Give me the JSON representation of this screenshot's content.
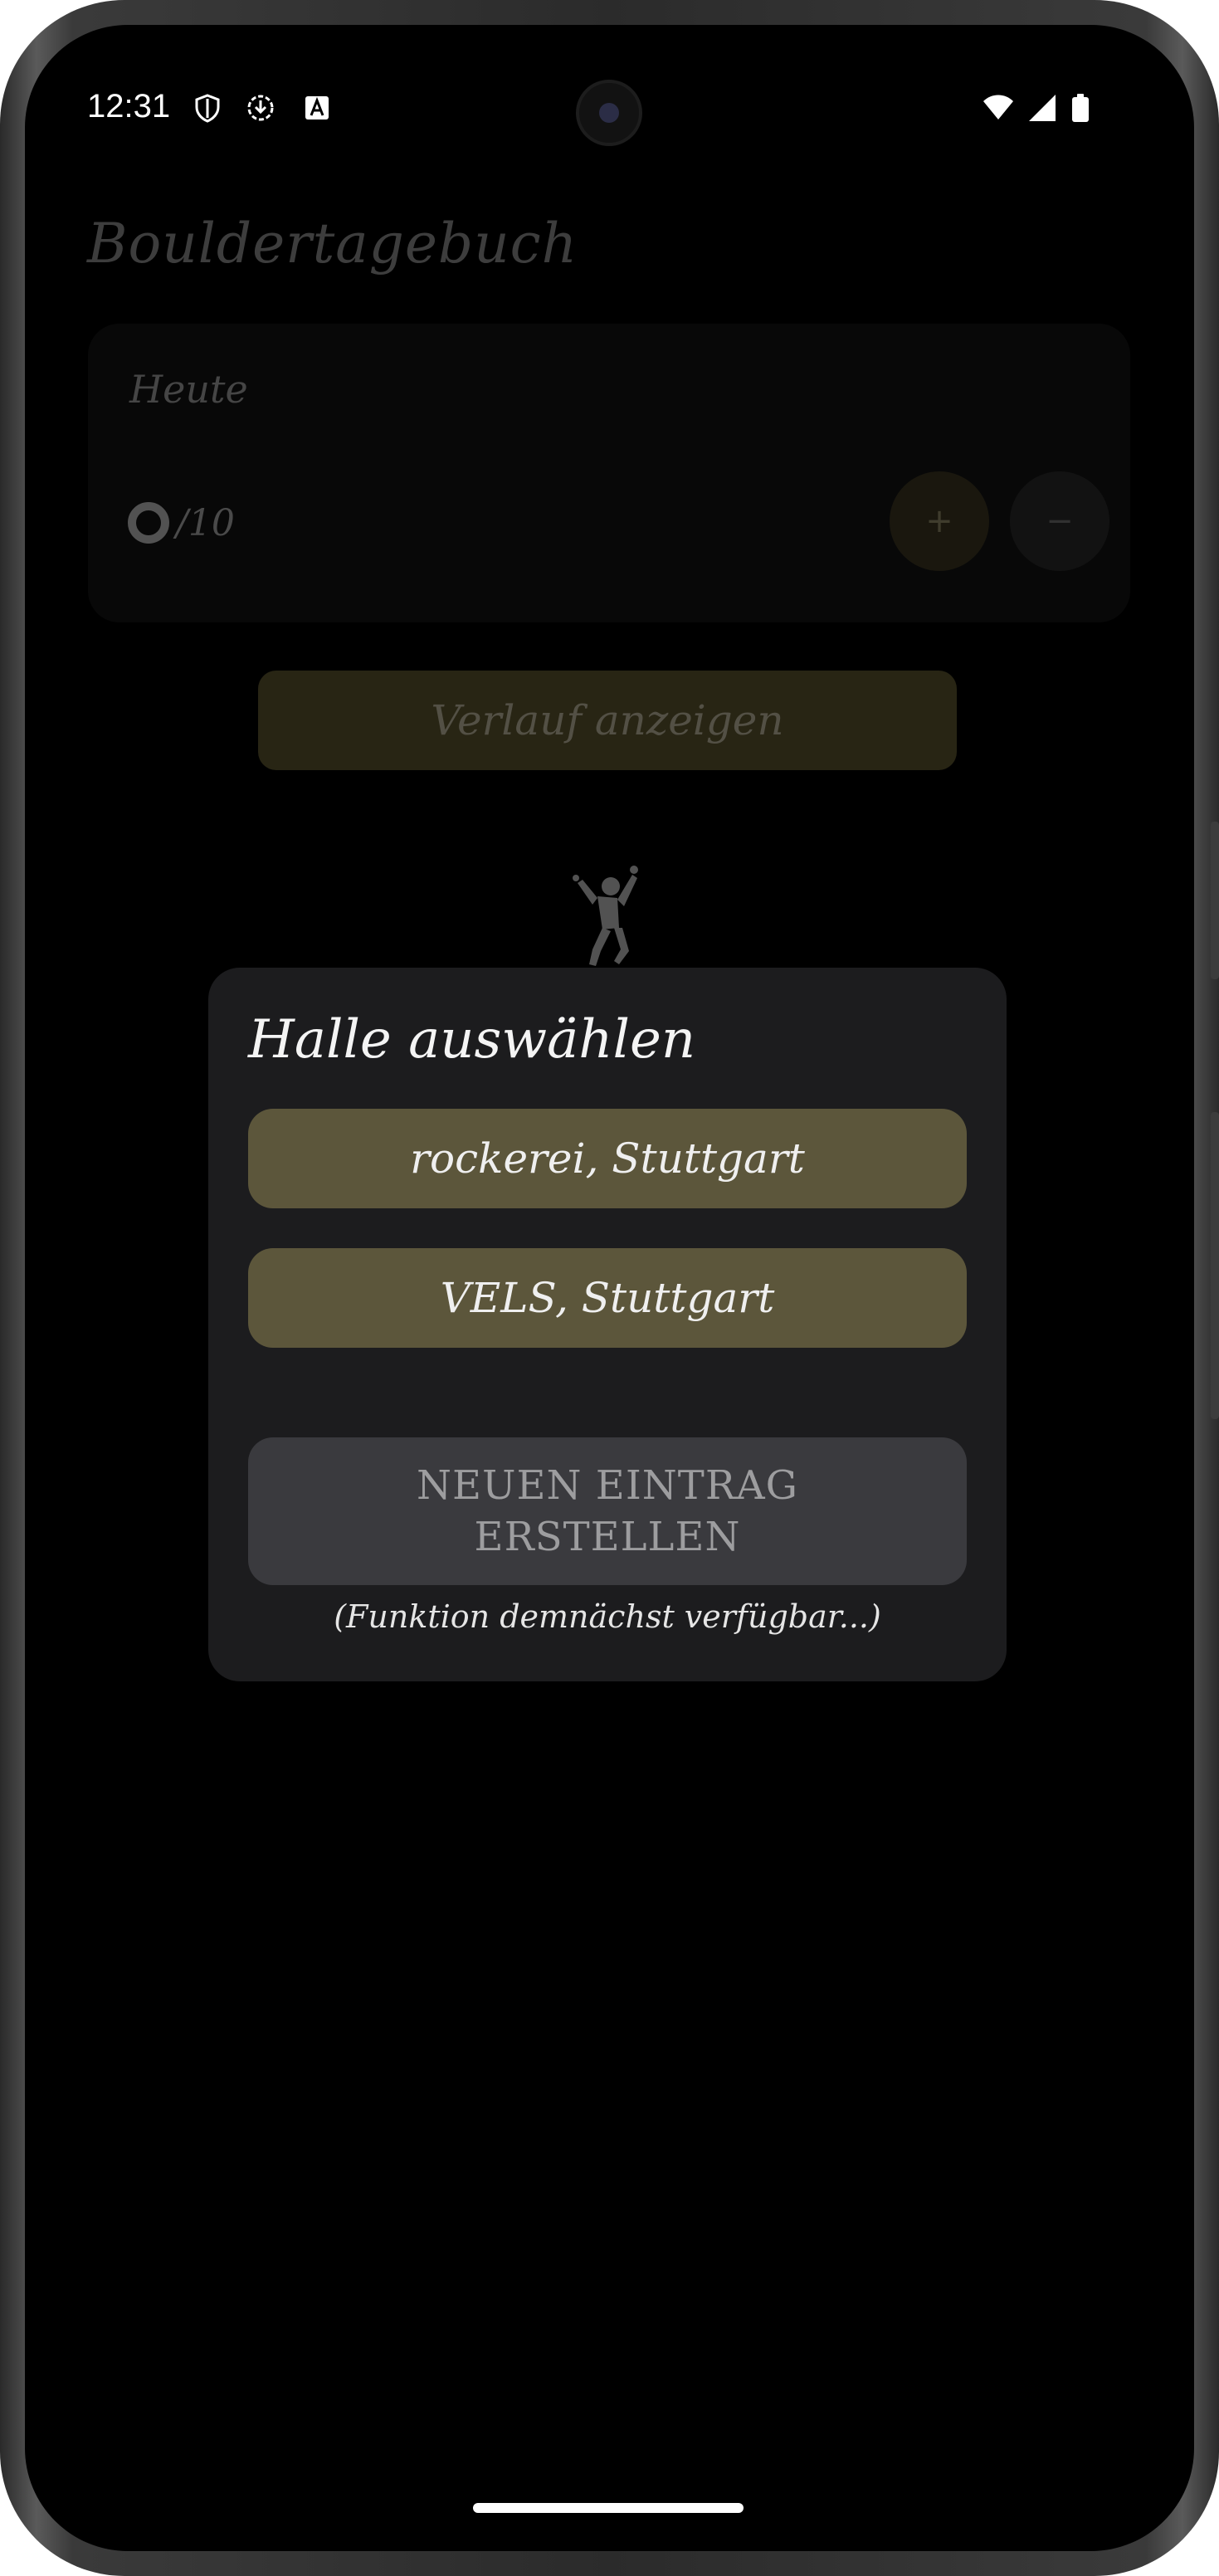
{
  "status_bar": {
    "time": "12:31",
    "icons": [
      "shield-icon",
      "download-icon",
      "text-icon",
      "wifi-icon",
      "signal-icon",
      "battery-icon"
    ]
  },
  "app": {
    "title": "Bouldertagebuch",
    "today_card": {
      "label": "Heute",
      "counter": "/10",
      "plus": "+",
      "minus": "−"
    },
    "history_button": "Verlauf anzeigen"
  },
  "dialog": {
    "title": "Halle auswählen",
    "gyms": [
      "rockerei, Stuttgart",
      "VELS, Stuttgart"
    ],
    "new_entry_line1": "NEUEN EINTRAG",
    "new_entry_line2": "ERSTELLEN",
    "note": "(Funktion demnächst verfügbar...)"
  },
  "colors": {
    "accent": "#5c563b",
    "dialog_bg": "#1c1c1e",
    "screen_bg": "#000000"
  }
}
